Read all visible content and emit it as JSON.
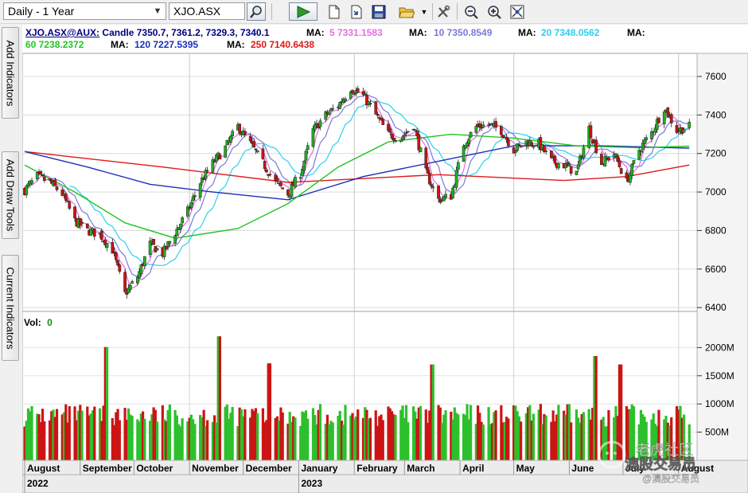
{
  "toolbar": {
    "period_select": "Daily - 1 Year",
    "symbol_input": "XJO.ASX",
    "icons": [
      "search-icon",
      "play-icon",
      "new-page-icon",
      "export-icon",
      "save-icon",
      "open-folder-icon",
      "dropdown-arrow-icon",
      "tools-icon",
      "zoom-out-icon",
      "zoom-in-icon",
      "zoom-fit-icon"
    ]
  },
  "side_tabs": [
    "Add Indicators",
    "Add Draw Tools",
    "Current Indicators"
  ],
  "price_header": {
    "symbol": "XJO.ASX@AUX:",
    "candle": "Candle 7350.7, 7361.2, 7329.3, 7340.1",
    "ma_label": "MA:",
    "ma": [
      {
        "text": "5 7331.1583",
        "color": "#e070e0"
      },
      {
        "text": "10 7350.8549",
        "color": "#7a7ad8"
      },
      {
        "text": "20 7348.0562",
        "color": "#2ad0f0"
      },
      {
        "text": "60 7238.2372",
        "color": "#22c422"
      },
      {
        "text": "120 7227.5395",
        "color": "#1c2fb8"
      },
      {
        "text": "250 7140.6438",
        "color": "#e01818"
      }
    ]
  },
  "volume_header": {
    "label": "Vol:",
    "value": "0"
  },
  "watermark": {
    "line1": "老虎社区",
    "line2": "澳股交易员",
    "line3": "@澳股交易员"
  },
  "chart_data": [
    {
      "type": "candlestick",
      "title": "XJO.ASX@AUX",
      "ylim": [
        6380,
        7720
      ],
      "yticks": [
        6400,
        6600,
        6800,
        7000,
        7200,
        7400,
        7600
      ],
      "grid": true,
      "months": [
        {
          "label": "August",
          "year": "2022"
        },
        {
          "label": "September"
        },
        {
          "label": "October"
        },
        {
          "label": "November"
        },
        {
          "label": "December"
        },
        {
          "label": "January",
          "year": "2023"
        },
        {
          "label": "February"
        },
        {
          "label": "March"
        },
        {
          "label": "April"
        },
        {
          "label": "May"
        },
        {
          "label": "June"
        },
        {
          "label": "July"
        },
        {
          "label": "August"
        }
      ],
      "close_path": [
        {
          "d": "2022-08-01",
          "c": 7010
        },
        {
          "d": "2022-08-08",
          "c": 7080
        },
        {
          "d": "2022-08-15",
          "c": 7050
        },
        {
          "d": "2022-08-22",
          "c": 6990
        },
        {
          "d": "2022-08-29",
          "c": 6850
        },
        {
          "d": "2022-09-05",
          "c": 6800
        },
        {
          "d": "2022-09-12",
          "c": 6780
        },
        {
          "d": "2022-09-19",
          "c": 6700
        },
        {
          "d": "2022-09-26",
          "c": 6470
        },
        {
          "d": "2022-10-03",
          "c": 6560
        },
        {
          "d": "2022-10-10",
          "c": 6730
        },
        {
          "d": "2022-10-17",
          "c": 6680
        },
        {
          "d": "2022-10-24",
          "c": 6790
        },
        {
          "d": "2022-10-31",
          "c": 6900
        },
        {
          "d": "2022-11-07",
          "c": 7050
        },
        {
          "d": "2022-11-14",
          "c": 7150
        },
        {
          "d": "2022-11-21",
          "c": 7230
        },
        {
          "d": "2022-11-28",
          "c": 7340
        },
        {
          "d": "2022-12-05",
          "c": 7250
        },
        {
          "d": "2022-12-12",
          "c": 7150
        },
        {
          "d": "2022-12-19",
          "c": 7050
        },
        {
          "d": "2022-12-26",
          "c": 6990
        },
        {
          "d": "2023-01-02",
          "c": 7100
        },
        {
          "d": "2023-01-09",
          "c": 7320
        },
        {
          "d": "2023-01-16",
          "c": 7400
        },
        {
          "d": "2023-01-23",
          "c": 7450
        },
        {
          "d": "2023-01-30",
          "c": 7540
        },
        {
          "d": "2023-02-06",
          "c": 7500
        },
        {
          "d": "2023-02-13",
          "c": 7400
        },
        {
          "d": "2023-02-20",
          "c": 7300
        },
        {
          "d": "2023-02-27",
          "c": 7280
        },
        {
          "d": "2023-03-06",
          "c": 7350
        },
        {
          "d": "2023-03-13",
          "c": 7100
        },
        {
          "d": "2023-03-20",
          "c": 6960
        },
        {
          "d": "2023-03-27",
          "c": 6980
        },
        {
          "d": "2023-04-03",
          "c": 7250
        },
        {
          "d": "2023-04-10",
          "c": 7340
        },
        {
          "d": "2023-04-17",
          "c": 7350
        },
        {
          "d": "2023-04-24",
          "c": 7320
        },
        {
          "d": "2023-05-01",
          "c": 7220
        },
        {
          "d": "2023-05-08",
          "c": 7260
        },
        {
          "d": "2023-05-15",
          "c": 7250
        },
        {
          "d": "2023-05-22",
          "c": 7160
        },
        {
          "d": "2023-05-29",
          "c": 7140
        },
        {
          "d": "2023-06-05",
          "c": 7100
        },
        {
          "d": "2023-06-12",
          "c": 7330
        },
        {
          "d": "2023-06-19",
          "c": 7150
        },
        {
          "d": "2023-06-26",
          "c": 7200
        },
        {
          "d": "2023-07-03",
          "c": 7050
        },
        {
          "d": "2023-07-10",
          "c": 7220
        },
        {
          "d": "2023-07-17",
          "c": 7310
        },
        {
          "d": "2023-07-24",
          "c": 7440
        },
        {
          "d": "2023-07-31",
          "c": 7320
        },
        {
          "d": "2023-08-07",
          "c": 7340
        }
      ],
      "moving_averages": [
        {
          "period": 250,
          "color": "#e01818",
          "points": [
            [
              "2022-08-01",
              7210
            ],
            [
              "2022-10-17",
              7130
            ],
            [
              "2022-12-26",
              7050
            ],
            [
              "2023-03-20",
              7090
            ],
            [
              "2023-05-29",
              7060
            ],
            [
              "2023-07-03",
              7080
            ],
            [
              "2023-08-07",
              7140
            ]
          ]
        },
        {
          "period": 120,
          "color": "#1c2fb8",
          "points": [
            [
              "2022-08-01",
              7210
            ],
            [
              "2022-09-05",
              7130
            ],
            [
              "2022-10-10",
              7040
            ],
            [
              "2022-11-14",
              7000
            ],
            [
              "2022-12-26",
              6960
            ],
            [
              "2023-02-06",
              7080
            ],
            [
              "2023-03-20",
              7160
            ],
            [
              "2023-05-01",
              7240
            ],
            [
              "2023-06-19",
              7240
            ],
            [
              "2023-08-07",
              7228
            ]
          ]
        },
        {
          "period": 60,
          "color": "#22c422",
          "points": [
            [
              "2022-08-01",
              7140
            ],
            [
              "2022-08-29",
              7000
            ],
            [
              "2022-09-26",
              6840
            ],
            [
              "2022-10-24",
              6760
            ],
            [
              "2022-11-28",
              6810
            ],
            [
              "2022-12-26",
              6940
            ],
            [
              "2023-01-23",
              7130
            ],
            [
              "2023-02-20",
              7260
            ],
            [
              "2023-03-27",
              7300
            ],
            [
              "2023-05-01",
              7280
            ],
            [
              "2023-06-05",
              7240
            ],
            [
              "2023-07-10",
              7230
            ],
            [
              "2023-08-07",
              7238
            ]
          ]
        }
      ]
    },
    {
      "type": "bar",
      "title": "Vol",
      "ylim": [
        0,
        2500
      ],
      "yticks": [
        500,
        1000,
        1500,
        2000
      ],
      "ytick_labels": [
        "500M",
        "1000M",
        "1500M",
        "2000M"
      ],
      "unit": "M",
      "typical_range": [
        600,
        1000
      ],
      "spikes": [
        {
          "d": "2022-09-16",
          "v": 2010
        },
        {
          "d": "2022-11-18",
          "v": 2200
        },
        {
          "d": "2022-12-16",
          "v": 1720
        },
        {
          "d": "2023-03-17",
          "v": 1700
        },
        {
          "d": "2023-06-16",
          "v": 1850
        },
        {
          "d": "2023-06-30",
          "v": 1700
        }
      ]
    }
  ]
}
